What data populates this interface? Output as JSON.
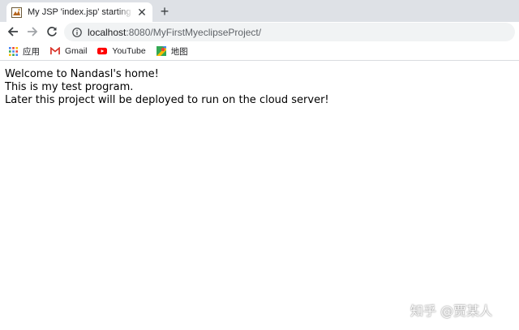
{
  "tab": {
    "title": "My JSP 'index.jsp' starting page",
    "close_glyph": "✕",
    "favicon": "jsp-favicon-icon"
  },
  "new_tab_glyph": "+",
  "toolbar": {
    "back_icon": "arrow-left-icon",
    "forward_icon": "arrow-right-icon",
    "reload_icon": "reload-icon",
    "info_icon": "info-icon",
    "url_host": "localhost",
    "url_rest": ":8080/MyFirstMyeclipseProject/"
  },
  "bookmarks": [
    {
      "label": "应用",
      "icon": "apps-grid-icon"
    },
    {
      "label": "Gmail",
      "icon": "gmail-icon"
    },
    {
      "label": "YouTube",
      "icon": "youtube-icon"
    },
    {
      "label": "地图",
      "icon": "maps-icon"
    }
  ],
  "content": {
    "line1": "Welcome to Nandasl's home!",
    "line2": "This is my test program.",
    "line3": "Later this project will be deployed to run on the cloud server!"
  },
  "watermark": "知乎 @贾某人",
  "colors": {
    "tabstrip": "#dee1e6",
    "omnibox": "#f1f3f4",
    "gmail_red": "#d93025",
    "youtube_red": "#ff0000",
    "apps_grid": "#4285f4"
  }
}
